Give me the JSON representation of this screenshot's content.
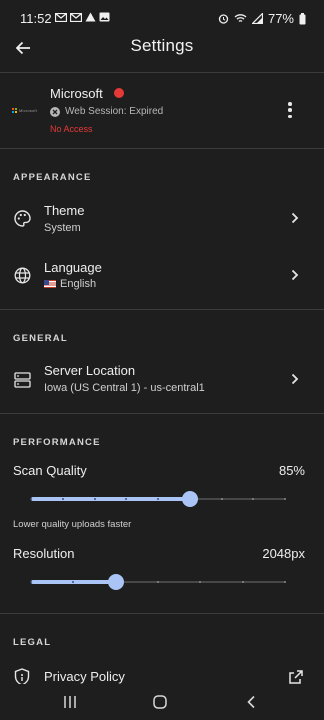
{
  "status_bar": {
    "time": "11:52",
    "battery": "77%",
    "left_icons": [
      "gmail-icon",
      "gmail-icon",
      "drive-icon",
      "image-icon"
    ],
    "right_icons": [
      "alarm-icon",
      "wifi-icon",
      "signal-icon",
      "battery-icon"
    ]
  },
  "header": {
    "title": "Settings",
    "back_icon": "arrow-left-icon"
  },
  "account": {
    "name": "Microsoft",
    "logo_text": "Microsoft",
    "status_color": "#e53935",
    "session": "Web Session: Expired",
    "access": "No Access",
    "menu_icon": "more-vertical-icon"
  },
  "sections": {
    "appearance": "APPEARANCE",
    "general": "GENERAL",
    "performance": "PERFORMANCE",
    "legal": "LEGAL"
  },
  "appearance": {
    "theme": {
      "label": "Theme",
      "value": "System",
      "icon": "palette-icon"
    },
    "language": {
      "label": "Language",
      "value": "English",
      "icon": "globe-icon",
      "flag": "us-flag-icon"
    }
  },
  "general": {
    "server": {
      "label": "Server Location",
      "value": "Iowa (US Central 1) - us-central1",
      "icon": "server-icon"
    }
  },
  "performance": {
    "scan_quality": {
      "label": "Scan Quality",
      "value": "85%",
      "level": 0.625,
      "hint": "Lower quality uploads faster"
    },
    "resolution": {
      "label": "Resolution",
      "value": "2048px",
      "level": 0.333
    }
  },
  "legal": {
    "privacy": {
      "label": "Privacy Policy",
      "icon": "shield-icon",
      "action_icon": "external-link-icon"
    }
  },
  "colors": {
    "background": "#1e1e1f",
    "accent": "#aac4f6",
    "danger": "#e53935",
    "divider": "#3c3c3e"
  },
  "nav": [
    "recents-icon",
    "home-icon",
    "back-icon"
  ]
}
